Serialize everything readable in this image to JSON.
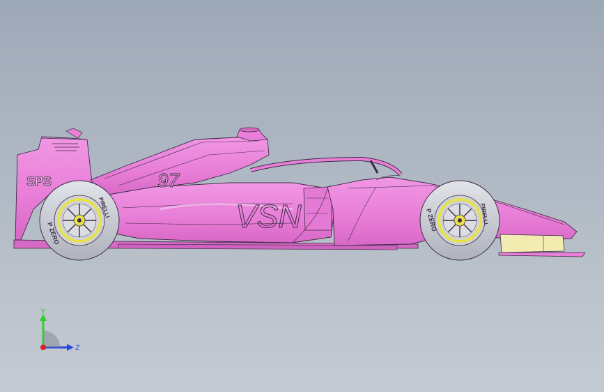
{
  "scene": {
    "background_top": "#9ea9b8",
    "background_bottom": "#c5cbd2",
    "body_color": "#e97fd8",
    "body_dark": "#c458b5",
    "edge_color": "#3b2a44",
    "rim_color": "#e8e24a",
    "tyre_color": "#c9ccd3",
    "endplate_color": "#f3ecb0"
  },
  "livery": {
    "sponsor": "SPS",
    "number": "97",
    "sidepod_logo": "VSN",
    "tyre_brand": "PIRELLI",
    "tyre_model": "P ZERO"
  },
  "triad": {
    "y_label": "Y",
    "z_label": "Z",
    "y_color": "#33cc33",
    "z_color": "#2a4bd8",
    "x_color": "#e02020"
  }
}
